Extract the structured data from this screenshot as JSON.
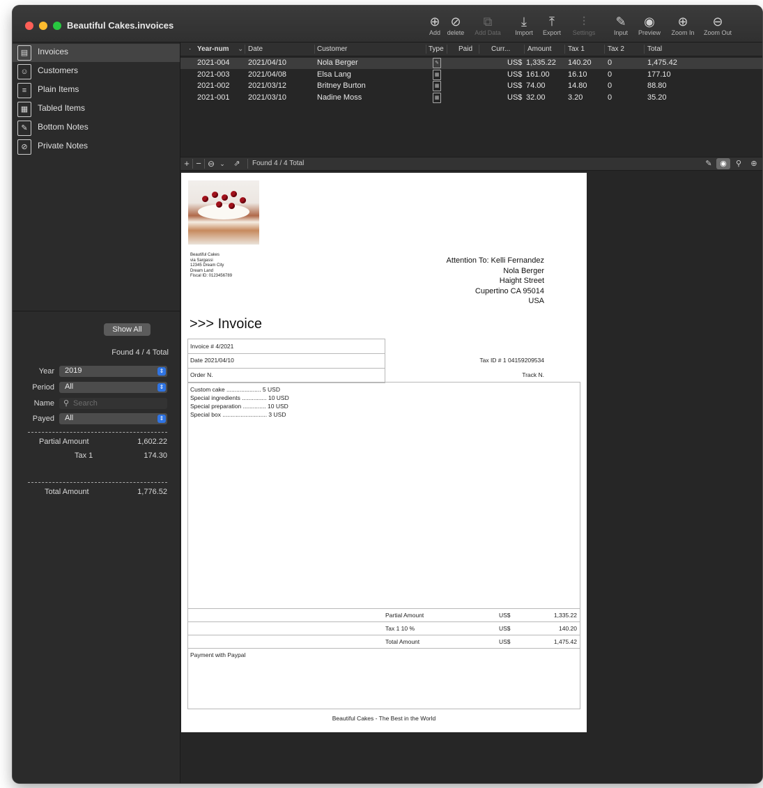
{
  "window": {
    "title": "Beautiful Cakes.invoices"
  },
  "toolbar": [
    {
      "name": "add-button",
      "icon": "plus-circle-icon",
      "glyph": "⊕",
      "label": "Add",
      "disabled": false
    },
    {
      "name": "delete-button",
      "icon": "prohibit-icon",
      "glyph": "⊘",
      "label": "delete",
      "disabled": false
    },
    {
      "name": "add-data-button",
      "icon": "add-data-icon",
      "glyph": "⧉",
      "label": "Add Data",
      "disabled": true
    },
    {
      "name": "import-button",
      "icon": "import-icon",
      "glyph": "⤓",
      "label": "Import",
      "disabled": false
    },
    {
      "name": "export-button",
      "icon": "export-icon",
      "glyph": "⤒",
      "label": "Export",
      "disabled": false
    },
    {
      "name": "settings-button",
      "icon": "sliders-icon",
      "glyph": "⫶",
      "label": "Settings",
      "disabled": true
    },
    {
      "name": "input-button",
      "icon": "edit-icon",
      "glyph": "✎",
      "label": "Input",
      "disabled": false
    },
    {
      "name": "preview-button",
      "icon": "eye-icon",
      "glyph": "◉",
      "label": "Preview",
      "disabled": false
    },
    {
      "name": "zoom-in-button",
      "icon": "zoom-in-icon",
      "glyph": "⊕",
      "label": "Zoom In",
      "disabled": false
    },
    {
      "name": "zoom-out-button",
      "icon": "zoom-out-icon",
      "glyph": "⊖",
      "label": "Zoom Out",
      "disabled": false
    }
  ],
  "sidebar": {
    "items": [
      {
        "label": "Invoices",
        "icon": "invoice-icon",
        "glyph": "▤",
        "selected": true
      },
      {
        "label": "Customers",
        "icon": "customers-icon",
        "glyph": "☺",
        "selected": false
      },
      {
        "label": "Plain Items",
        "icon": "plain-items-icon",
        "glyph": "≡",
        "selected": false
      },
      {
        "label": "Tabled Items",
        "icon": "table-icon",
        "glyph": "▦",
        "selected": false
      },
      {
        "label": "Bottom Notes",
        "icon": "notes-icon",
        "glyph": "✎",
        "selected": false
      },
      {
        "label": "Private Notes",
        "icon": "private-notes-icon",
        "glyph": "⊘",
        "selected": false
      }
    ],
    "show_all_label": "Show All",
    "found": "Found 4 / 4 Total",
    "filters": {
      "year_label": "Year",
      "year_value": "2019",
      "period_label": "Period",
      "period_value": "All",
      "name_label": "Name",
      "name_placeholder": "Search",
      "payed_label": "Payed",
      "payed_value": "All"
    },
    "summary": {
      "partial_label": "Partial Amount",
      "partial_value": "1,602.22",
      "tax1_label": "Tax 1",
      "tax1_value": "174.30",
      "total_label": "Total Amount",
      "total_value": "1,776.52"
    }
  },
  "table": {
    "columns": [
      "Year-num",
      "Date",
      "Customer",
      "Type",
      "Paid",
      "Curr...",
      "Amount",
      "Tax 1",
      "Tax 2",
      "Total"
    ],
    "rows": [
      {
        "num": "2021-004",
        "date": "2021/04/10",
        "customer": "Nola Berger",
        "type_icon": "edit-doc-icon",
        "curr": "US$",
        "amount": "1,335.22",
        "tax1": "140.20",
        "tax2": "0",
        "total": "1,475.42",
        "selected": true
      },
      {
        "num": "2021-003",
        "date": "2021/04/08",
        "customer": "Elsa Lang",
        "type_icon": "table-doc-icon",
        "curr": "US$",
        "amount": "161.00",
        "tax1": "16.10",
        "tax2": "0",
        "total": "177.10",
        "selected": false
      },
      {
        "num": "2021-002",
        "date": "2021/03/12",
        "customer": "Britney Burton",
        "type_icon": "table-doc-icon",
        "curr": "US$",
        "amount": "74.00",
        "tax1": "14.80",
        "tax2": "0",
        "total": "88.80",
        "selected": false
      },
      {
        "num": "2021-001",
        "date": "2021/03/10",
        "customer": "Nadine Moss",
        "type_icon": "table-doc-icon",
        "curr": "US$",
        "amount": "32.00",
        "tax1": "3.20",
        "tax2": "0",
        "total": "35.20",
        "selected": false
      }
    ],
    "found": "Found 4 / 4 Total"
  },
  "invoice": {
    "company_lines": [
      "Beautiful Cakes",
      "via Sargassi",
      "12345 Dream City",
      "Dream Land",
      "Fiscal ID: 0123456789"
    ],
    "attention_lines": [
      "Attention To: Kelli Fernandez",
      "Nola Berger",
      "Haight Street",
      "Cupertino CA 95014",
      "USA"
    ],
    "title": ">>> Invoice",
    "invoice_no": "Invoice # 4/2021",
    "date": "Date 2021/04/10",
    "tax_id": "Tax ID # 1 04159209534",
    "order": "Order N.",
    "track": "Track N.",
    "items": [
      "Custom cake      ..................... 5 USD",
      "Special ingredients ............... 10 USD",
      "Special preparation .............. 10 USD",
      "Special box ........................... 3 USD"
    ],
    "partial_label": "Partial Amount",
    "partial_curr": "US$",
    "partial_value": "1,335.22",
    "tax_label": "Tax 1 10 %",
    "tax_curr": "US$",
    "tax_value": "140.20",
    "total_label": "Total Amount",
    "total_curr": "US$",
    "total_value": "1,475.42",
    "payment": "Payment with Paypal",
    "footer": "Beautiful Cakes - The Best in the World"
  }
}
